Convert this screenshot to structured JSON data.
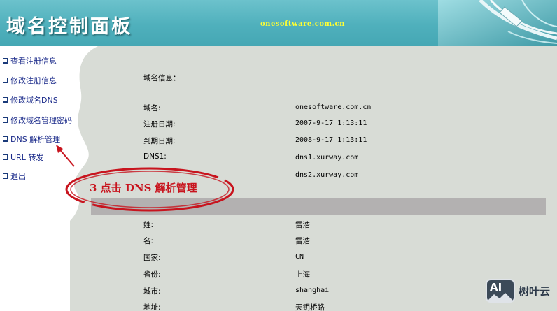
{
  "header": {
    "title": "域名控制面板",
    "site": "onesoftware.com.cn"
  },
  "menu": [
    {
      "label": "查看注册信息"
    },
    {
      "label": "修改注册信息"
    },
    {
      "label": "修改域名DNS"
    },
    {
      "label": "修改域名管理密码"
    },
    {
      "label": "DNS 解析管理"
    },
    {
      "label": "URL 转发"
    },
    {
      "label": "退出"
    }
  ],
  "domain_info": {
    "heading": "域名信息：",
    "rows": [
      {
        "label": "域名:",
        "value": "onesoftware.com.cn"
      },
      {
        "label": "注册日期:",
        "value": "2007-9-17 1:13:11"
      },
      {
        "label": "到期日期:",
        "value": "2008-9-17 1:13:11"
      },
      {
        "label": "DNS1:",
        "value": "dns1.xurway.com"
      },
      {
        "label": "",
        "value": "dns2.xurway.com"
      }
    ]
  },
  "contact_info": {
    "rows": [
      {
        "label": "姓:",
        "value": "雷浩"
      },
      {
        "label": "名:",
        "value": "雷浩"
      },
      {
        "label": "国家:",
        "value": "CN"
      },
      {
        "label": "省份:",
        "value": "上海"
      },
      {
        "label": "城市:",
        "value": "shanghai"
      },
      {
        "label": "地址:",
        "value": "天钥桥路"
      }
    ]
  },
  "annotation": {
    "text": "3 点击 DNS 解析管理",
    "color": "#c8141e"
  },
  "watermark": {
    "logo": "AI",
    "name": "树叶云"
  },
  "colors": {
    "header": "#4fb0bc",
    "content_bg": "#d8dcd6",
    "menu_text": "#1a2a8a",
    "site_text": "#ffff33"
  }
}
